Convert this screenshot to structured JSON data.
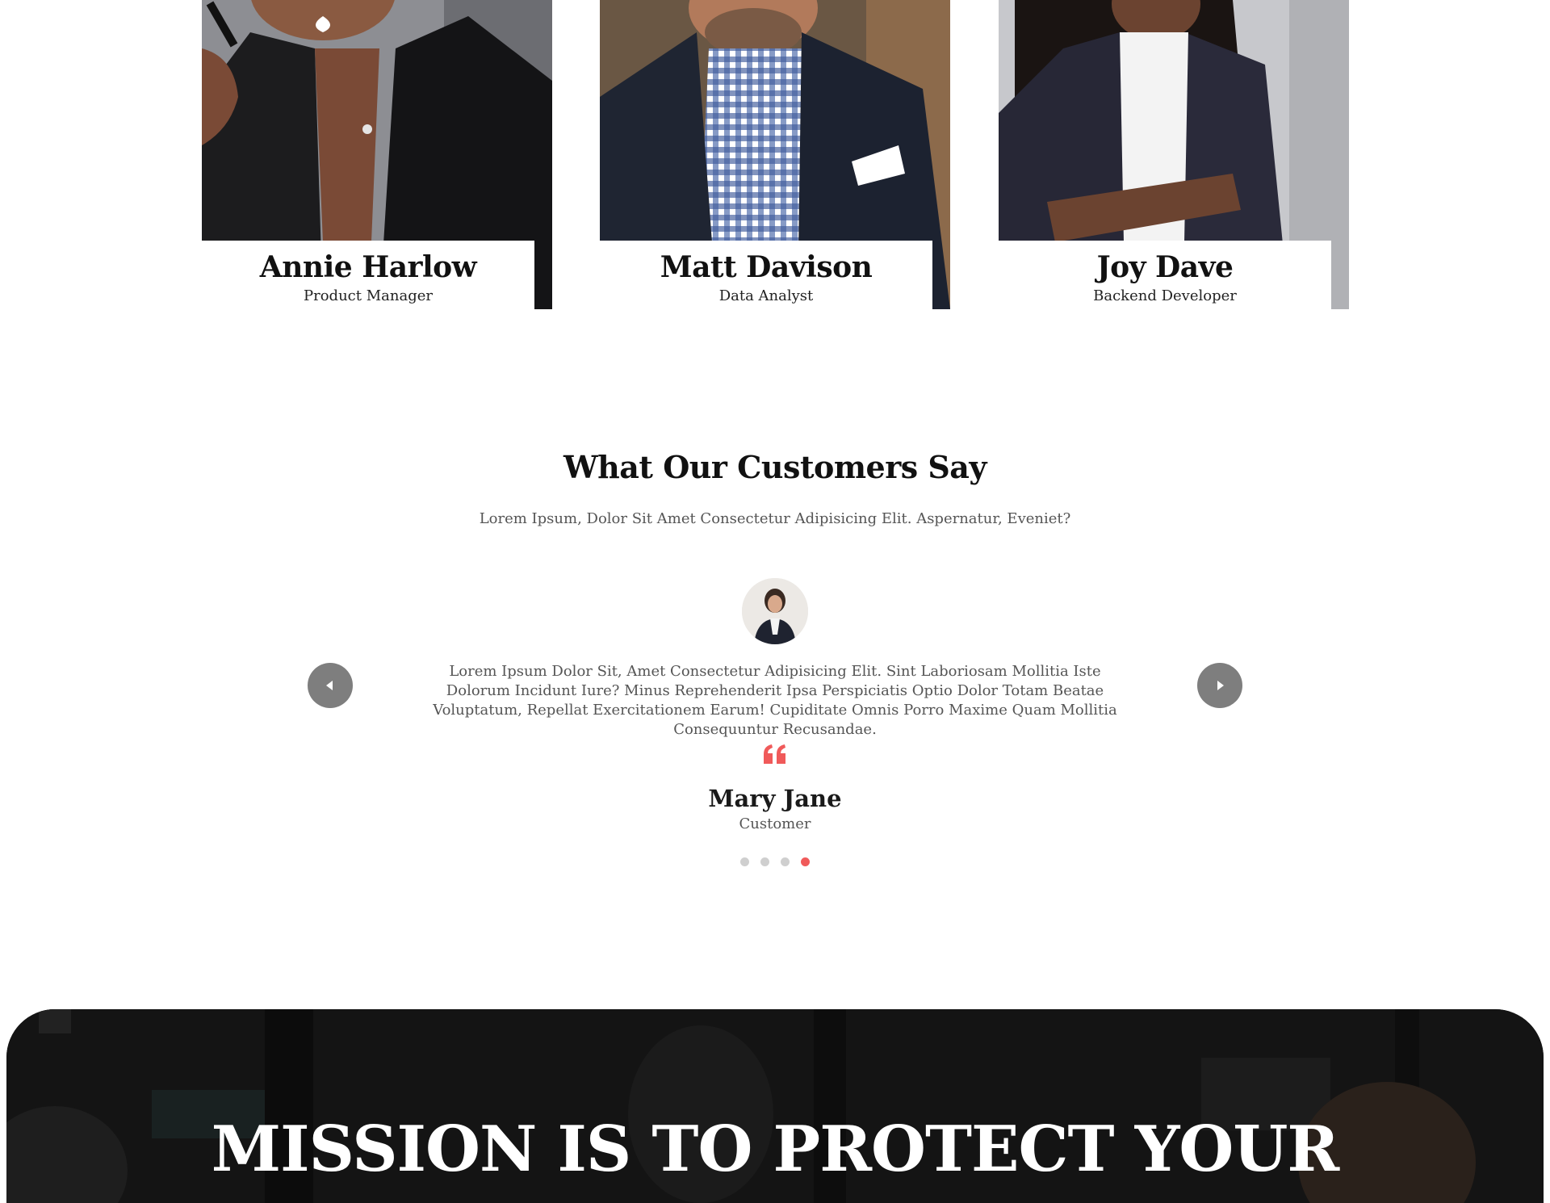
{
  "team": {
    "members": [
      {
        "name": "Annie Harlow",
        "role": "Product Manager"
      },
      {
        "name": "Matt Davison",
        "role": "Data Analyst"
      },
      {
        "name": "Joy Dave",
        "role": "Backend Developer"
      }
    ]
  },
  "testimonials": {
    "title": "What Our Customers Say",
    "subtitle": "Lorem Ipsum, Dolor Sit Amet Consectetur Adipisicing Elit. Aspernatur, Eveniet?",
    "quote": "Lorem Ipsum Dolor Sit, Amet Consectetur Adipisicing Elit. Sint Laboriosam Mollitia Iste Dolorum Incidunt Iure? Minus Reprehenderit Ipsa Perspiciatis Optio Dolor Totam Beatae Voluptatum, Repellat Exercitationem Earum! Cupiditate Omnis Porro Maxime Quam Mollitia Consequuntur Recusandae.",
    "author_name": "Mary Jane",
    "author_role": "Customer",
    "slide_count": 4,
    "active_slide": 4
  },
  "mission": {
    "title": "MISSION IS TO PROTECT YOUR"
  },
  "colors": {
    "accent": "#f05a5a",
    "arrow_bg": "#7e7e7e",
    "dot_inactive": "#cfcfcf"
  },
  "icons": {
    "prev": "caret-left-icon",
    "next": "caret-right-icon",
    "quote": "quote-icon"
  }
}
